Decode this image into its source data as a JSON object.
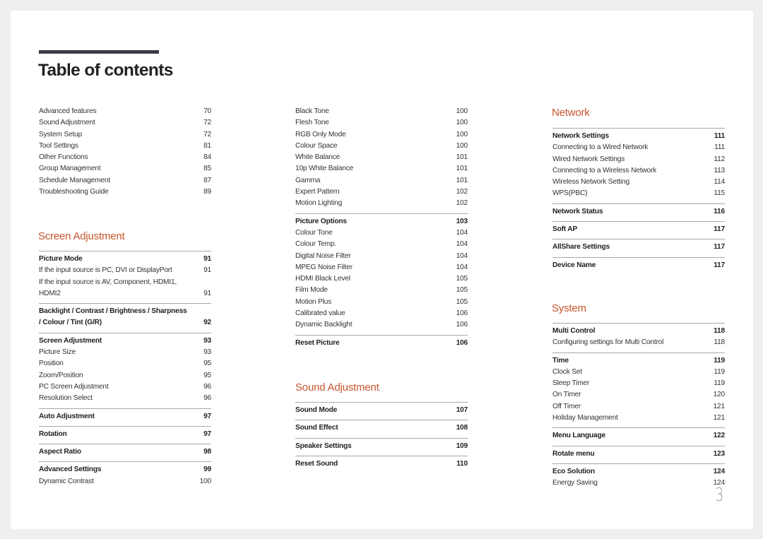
{
  "page": {
    "title": "Table of contents",
    "page_number": "3",
    "accent_color": "#c8562e"
  },
  "intro_list": [
    {
      "label": "Advanced features",
      "page": "70"
    },
    {
      "label": "Sound Adjustment",
      "page": "72"
    },
    {
      "label": "System Setup",
      "page": "72"
    },
    {
      "label": "Tool Settings",
      "page": "81"
    },
    {
      "label": "Other Functions",
      "page": "84"
    },
    {
      "label": "Group Management",
      "page": "85"
    },
    {
      "label": "Schedule Management",
      "page": "87"
    },
    {
      "label": "Troubleshooting Guide",
      "page": "89"
    }
  ],
  "screen_adjustment": {
    "title": "Screen Adjustment",
    "groups": [
      {
        "label": "Picture Mode",
        "page": "91",
        "items": [
          {
            "label": "If the input source is PC, DVI or DisplayPort",
            "page": "91"
          },
          {
            "label": "If the input source is AV, Component, HDMI1, HDMI2",
            "page": "91"
          }
        ]
      },
      {
        "label": "Backlight / Contrast / Brightness / Sharpness / Colour / Tint (G/R)",
        "page": "92",
        "items": []
      },
      {
        "label": "Screen Adjustment",
        "page": "93",
        "items": [
          {
            "label": "Picture Size",
            "page": "93"
          },
          {
            "label": "Position",
            "page": "95"
          },
          {
            "label": "Zoom/Position",
            "page": "95"
          },
          {
            "label": "PC Screen Adjustment",
            "page": "96"
          },
          {
            "label": "Resolution Select",
            "page": "96"
          }
        ]
      },
      {
        "label": "Auto Adjustment",
        "page": "97",
        "items": []
      },
      {
        "label": "Rotation",
        "page": "97",
        "items": []
      },
      {
        "label": "Aspect Ratio",
        "page": "98",
        "items": []
      },
      {
        "label": "Advanced Settings",
        "page": "99",
        "items": [
          {
            "label": "Dynamic Contrast",
            "page": "100"
          }
        ]
      }
    ]
  },
  "column2": {
    "continued_items": [
      {
        "label": "Black Tone",
        "page": "100"
      },
      {
        "label": "Flesh Tone",
        "page": "100"
      },
      {
        "label": "RGB Only Mode",
        "page": "100"
      },
      {
        "label": "Colour Space",
        "page": "100"
      },
      {
        "label": "White Balance",
        "page": "101"
      },
      {
        "label": "10p White Balance",
        "page": "101"
      },
      {
        "label": "Gamma",
        "page": "101"
      },
      {
        "label": "Expert Pattern",
        "page": "102"
      },
      {
        "label": "Motion Lighting",
        "page": "102"
      }
    ],
    "groups": [
      {
        "label": "Picture Options",
        "page": "103",
        "items": [
          {
            "label": "Colour Tone",
            "page": "104"
          },
          {
            "label": "Colour Temp.",
            "page": "104"
          },
          {
            "label": "Digital Noise Filter",
            "page": "104"
          },
          {
            "label": "MPEG Noise Filter",
            "page": "104"
          },
          {
            "label": "HDMI Black Level",
            "page": "105"
          },
          {
            "label": "Film Mode",
            "page": "105"
          },
          {
            "label": "Motion Plus",
            "page": "105"
          },
          {
            "label": "Calibrated value",
            "page": "106"
          },
          {
            "label": "Dynamic Backlight",
            "page": "106"
          }
        ]
      },
      {
        "label": "Reset Picture",
        "page": "106",
        "items": []
      }
    ]
  },
  "sound_adjustment": {
    "title": "Sound Adjustment",
    "groups": [
      {
        "label": "Sound Mode",
        "page": "107",
        "items": []
      },
      {
        "label": "Sound Effect",
        "page": "108",
        "items": []
      },
      {
        "label": "Speaker Settings",
        "page": "109",
        "items": []
      },
      {
        "label": "Reset Sound",
        "page": "110",
        "items": []
      }
    ]
  },
  "network": {
    "title": "Network",
    "groups": [
      {
        "label": "Network Settings",
        "page": "111",
        "items": [
          {
            "label": "Connecting to a Wired Network",
            "page": "111"
          },
          {
            "label": "Wired Network Settings",
            "page": "112"
          },
          {
            "label": "Connecting to a Wireless Network",
            "page": "113"
          },
          {
            "label": "Wireless Network Setting",
            "page": "114"
          },
          {
            "label": "WPS(PBC)",
            "page": "115"
          }
        ]
      },
      {
        "label": "Network Status",
        "page": "116",
        "items": []
      },
      {
        "label": "Soft AP",
        "page": "117",
        "items": []
      },
      {
        "label": "AllShare Settings",
        "page": "117",
        "items": []
      },
      {
        "label": "Device Name",
        "page": "117",
        "items": []
      }
    ]
  },
  "system": {
    "title": "System",
    "groups": [
      {
        "label": "Multi Control",
        "page": "118",
        "items": [
          {
            "label": "Configuring settings for Multi Control",
            "page": "118"
          }
        ]
      },
      {
        "label": "Time",
        "page": "119",
        "items": [
          {
            "label": "Clock Set",
            "page": "119"
          },
          {
            "label": "Sleep Timer",
            "page": "119"
          },
          {
            "label": "On Timer",
            "page": "120"
          },
          {
            "label": "Off Timer",
            "page": "121"
          },
          {
            "label": "Holiday Management",
            "page": "121"
          }
        ]
      },
      {
        "label": "Menu Language",
        "page": "122",
        "items": []
      },
      {
        "label": "Rotate menu",
        "page": "123",
        "items": []
      },
      {
        "label": "Eco Solution",
        "page": "124",
        "items": [
          {
            "label": "Energy Saving",
            "page": "124"
          }
        ]
      }
    ]
  }
}
